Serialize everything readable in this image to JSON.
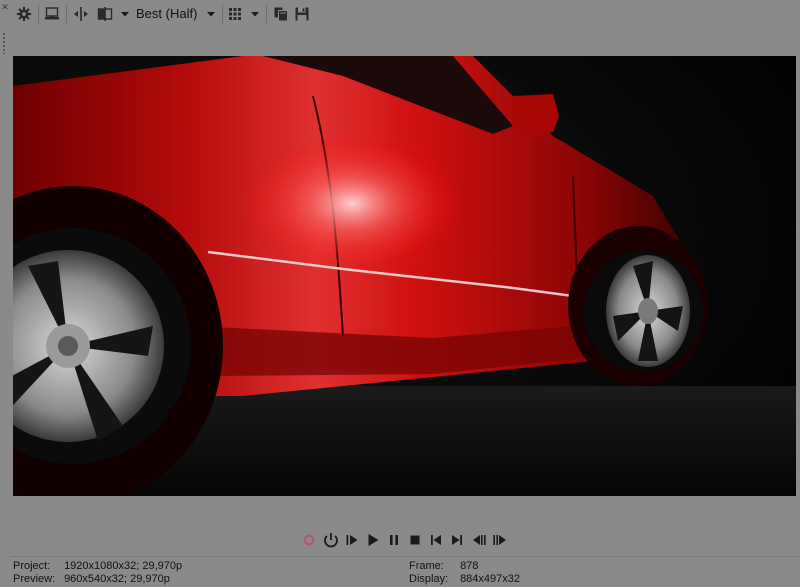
{
  "toolbar": {
    "quality_value": "Best (Half)",
    "icons": [
      "close-icon",
      "gear-icon",
      "external-monitor-icon",
      "split-screen-icon",
      "split-mode-icon",
      "chevron-down-icon",
      "grid-overlay-icon",
      "copy-snapshot-icon",
      "save-snapshot-icon"
    ]
  },
  "transport": {
    "record_color": "#c0506a",
    "buttons": [
      "record",
      "loop-playback",
      "play-from-start",
      "play",
      "pause",
      "stop",
      "previous-frame-marker",
      "next-frame-marker",
      "previous-frame",
      "next-frame"
    ]
  },
  "status": {
    "project_label": "Project:",
    "project_value": "1920x1080x32; 29,970p",
    "preview_label": "Preview:",
    "preview_value": "960x540x32; 29,970p",
    "frame_label": "Frame:",
    "frame_value": "878",
    "display_label": "Display:",
    "display_value": "884x497x32"
  }
}
